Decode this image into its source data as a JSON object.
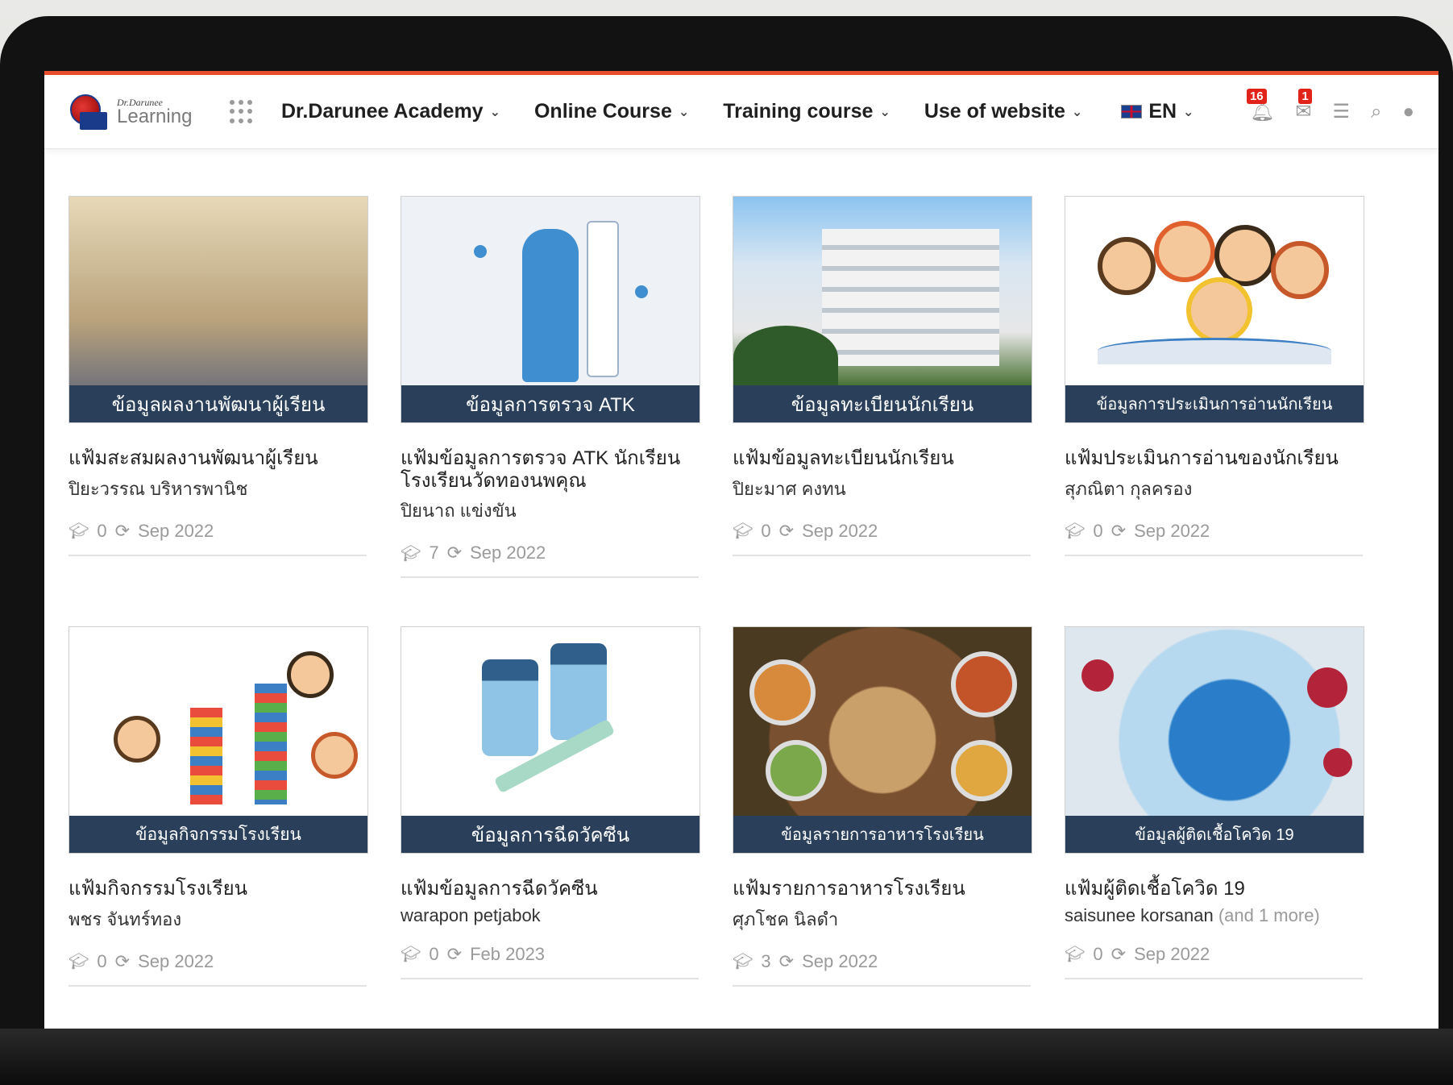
{
  "logo": {
    "small": "Dr.Darunee",
    "big": "Learning"
  },
  "nav": [
    {
      "label": "Dr.Darunee Academy"
    },
    {
      "label": "Online Course"
    },
    {
      "label": "Training course"
    },
    {
      "label": "Use of website"
    }
  ],
  "language": "EN",
  "notifications": {
    "count": "16",
    "messages": "1"
  },
  "colors": {
    "accent": "#e74c2c",
    "banner": "#2a3f5a",
    "badge": "#e2231a"
  },
  "courses": [
    {
      "banner": "ข้อมูลผลงานพัฒนาผู้เรียน",
      "title": "แฟ้มสะสมผลงานพัฒนาผู้เรียน",
      "author": "ปิยะวรรณ บริหารพานิช",
      "author_more": "",
      "students": "0",
      "date": "Sep 2022"
    },
    {
      "banner": "ข้อมูลการตรวจ ATK",
      "title": "แฟ้มข้อมูลการตรวจ ATK นักเรียนโรงเรียนวัดทองนพคุณ",
      "author": "ปิยนาถ แข่งขัน",
      "author_more": "",
      "students": "7",
      "date": "Sep 2022"
    },
    {
      "banner": "ข้อมูลทะเบียนนักเรียน",
      "title": "แฟ้มข้อมูลทะเบียนนักเรียน",
      "author": "ปิยะมาศ คงทน",
      "author_more": "",
      "students": "0",
      "date": "Sep 2022"
    },
    {
      "banner": "ข้อมูลการประเมินการอ่านนักเรียน",
      "title": "แฟ้มประเมินการอ่านของนักเรียน",
      "author": "สุภณิตา กุลครอง",
      "author_more": "",
      "students": "0",
      "date": "Sep 2022"
    },
    {
      "banner": "ข้อมูลกิจกรรมโรงเรียน",
      "title": "แฟ้มกิจกรรมโรงเรียน",
      "author": "พชร จันทร์ทอง",
      "author_more": "",
      "students": "0",
      "date": "Sep 2022"
    },
    {
      "banner": "ข้อมูลการฉีดวัคซีน",
      "title": "แฟ้มข้อมูลการฉีดวัคซีน",
      "author": "warapon petjabok",
      "author_more": "",
      "students": "0",
      "date": "Feb 2023"
    },
    {
      "banner": "ข้อมูลรายการอาหารโรงเรียน",
      "title": "แฟ้มรายการอาหารโรงเรียน",
      "author": "ศุภโชค นิลดำ",
      "author_more": "",
      "students": "3",
      "date": "Sep 2022"
    },
    {
      "banner": "ข้อมูลผู้ติดเชื้อโควิด 19",
      "title": "แฟ้มผู้ติดเชื้อโควิด 19",
      "author": "saisunee korsanan",
      "author_more": "(and 1 more)",
      "students": "0",
      "date": "Sep 2022"
    }
  ]
}
